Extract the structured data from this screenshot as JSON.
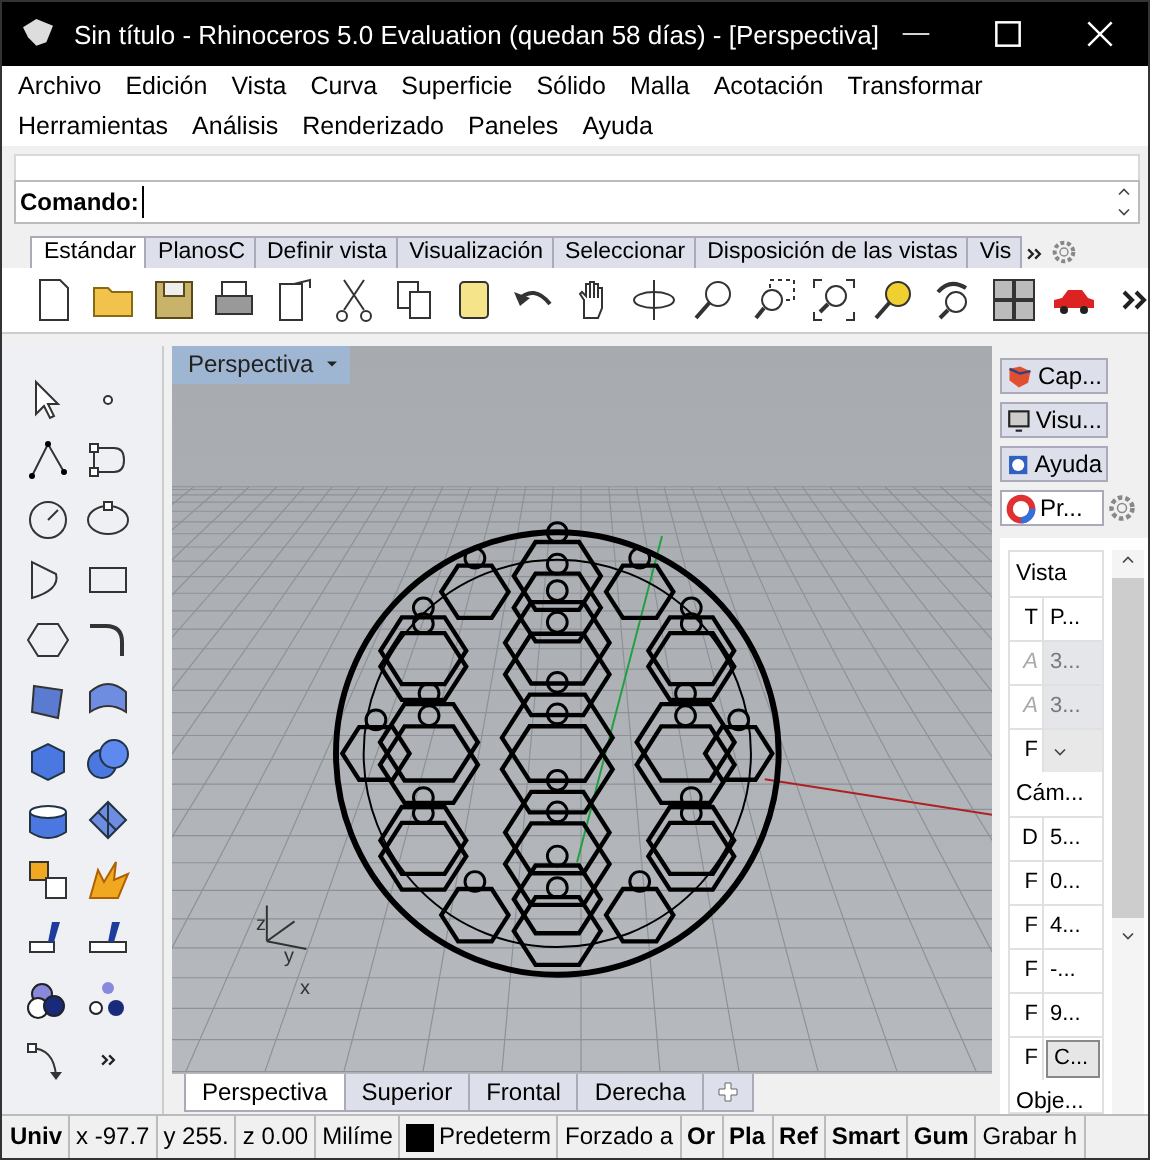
{
  "window": {
    "title": "Sin título - Rhinoceros 5.0 Evaluation (quedan 58 días) - [Perspectiva]"
  },
  "menu_rows": [
    {
      "items": [
        "Archivo",
        "Edición",
        "Vista",
        "Curva",
        "Superficie",
        "Sólido",
        "Malla",
        "Acotación",
        "Transformar"
      ]
    },
    {
      "items": [
        "Herramientas",
        "Análisis",
        "Renderizado",
        "Paneles",
        "Ayuda"
      ]
    }
  ],
  "command": {
    "label": "Comando:"
  },
  "toolbar_tabs": [
    {
      "label": "Estándar",
      "selected": true
    },
    {
      "label": "PlanosC",
      "selected": false
    },
    {
      "label": "Definir vista",
      "selected": false
    },
    {
      "label": "Visualización",
      "selected": false
    },
    {
      "label": "Seleccionar",
      "selected": false
    },
    {
      "label": "Disposición de las vistas",
      "selected": false
    },
    {
      "label": "Vis",
      "selected": false
    }
  ],
  "viewport": {
    "title": "Perspectiva",
    "axis_labels": [
      "z",
      "y",
      "x"
    ]
  },
  "viewport_tabs": [
    {
      "label": "Perspectiva",
      "selected": true
    },
    {
      "label": "Superior",
      "selected": false
    },
    {
      "label": "Frontal",
      "selected": false
    },
    {
      "label": "Derecha",
      "selected": false
    }
  ],
  "side_panel": {
    "tabs": [
      {
        "label": "Cap...",
        "selected": false
      },
      {
        "label": "Visu...",
        "selected": false
      },
      {
        "label": "Ayuda",
        "selected": false
      },
      {
        "label": "Pr...",
        "selected": true
      }
    ],
    "sections": [
      {
        "title": "Vista",
        "rows": [
          {
            "kind": "text",
            "label": "T",
            "value": "P...",
            "disabled": false
          },
          {
            "kind": "text",
            "label": "A",
            "value": "3...",
            "disabled": true
          },
          {
            "kind": "text",
            "label": "A",
            "value": "3...",
            "disabled": true
          },
          {
            "kind": "dropdown",
            "label": "F",
            "disabled": false
          }
        ]
      },
      {
        "title": "Cám...",
        "rows": [
          {
            "kind": "text",
            "label": "D",
            "value": "5...",
            "disabled": false
          },
          {
            "kind": "text",
            "label": "F",
            "value": "0...",
            "disabled": false
          },
          {
            "kind": "text",
            "label": "F",
            "value": "4...",
            "disabled": false
          },
          {
            "kind": "text",
            "label": "F",
            "value": "-...",
            "disabled": false
          },
          {
            "kind": "text",
            "label": "F",
            "value": "9...",
            "disabled": false
          },
          {
            "kind": "button",
            "label": "F",
            "value": "C...",
            "disabled": false
          }
        ]
      },
      {
        "title": "Obje..."
      }
    ]
  },
  "status_bar": [
    {
      "text": "Univ",
      "on": true
    },
    {
      "text": "x -97.7",
      "on": false
    },
    {
      "text": "y 255.",
      "on": false
    },
    {
      "text": "z 0.00",
      "on": false
    },
    {
      "text": "Milíme",
      "on": false
    },
    {
      "text": "Predeterm",
      "on": false,
      "color": "#000000"
    },
    {
      "text": "Forzado a",
      "on": false
    },
    {
      "text": "Or",
      "on": true
    },
    {
      "text": "Pla",
      "on": true
    },
    {
      "text": "Ref",
      "on": true
    },
    {
      "text": "Smart",
      "on": true
    },
    {
      "text": "Gum",
      "on": true
    },
    {
      "text": "Grabar h",
      "on": false
    }
  ]
}
